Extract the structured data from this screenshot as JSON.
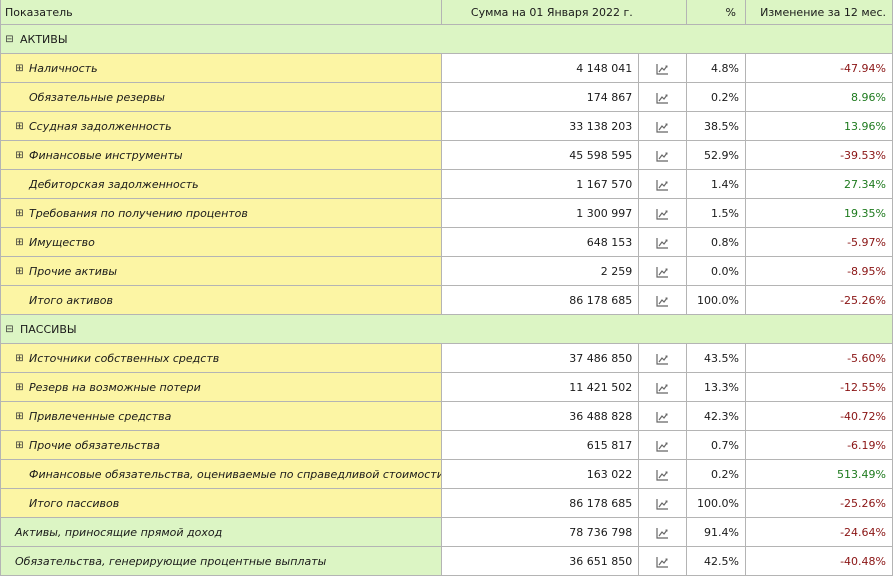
{
  "header": {
    "col_name": "Показатель",
    "col_sum": "Сумма на 01 Января 2022 г.",
    "col_pct": "%",
    "col_change": "Изменение за 12 мес."
  },
  "rows": [
    {
      "type": "section",
      "label": "АКТИВЫ",
      "expander": "⊟"
    },
    {
      "type": "item",
      "color": "yel",
      "expander": "⊞",
      "label": "Наличность",
      "sum": "4 148 041",
      "pct": "4.8%",
      "change": "-47.94%",
      "sign": "neg"
    },
    {
      "type": "item",
      "color": "yel",
      "expander": "",
      "label": "Обязательные резервы",
      "sum": "174 867",
      "pct": "0.2%",
      "change": "8.96%",
      "sign": "pos"
    },
    {
      "type": "item",
      "color": "yel",
      "expander": "⊞",
      "label": "Ссудная задолженность",
      "sum": "33 138 203",
      "pct": "38.5%",
      "change": "13.96%",
      "sign": "pos"
    },
    {
      "type": "item",
      "color": "yel",
      "expander": "⊞",
      "label": "Финансовые инструменты",
      "sum": "45 598 595",
      "pct": "52.9%",
      "change": "-39.53%",
      "sign": "neg"
    },
    {
      "type": "item",
      "color": "yel",
      "expander": "",
      "label": "Дебиторская задолженность",
      "sum": "1 167 570",
      "pct": "1.4%",
      "change": "27.34%",
      "sign": "pos"
    },
    {
      "type": "item",
      "color": "yel",
      "expander": "⊞",
      "label": "Требования по получению процентов",
      "sum": "1 300 997",
      "pct": "1.5%",
      "change": "19.35%",
      "sign": "pos"
    },
    {
      "type": "item",
      "color": "yel",
      "expander": "⊞",
      "label": "Имущество",
      "sum": "648 153",
      "pct": "0.8%",
      "change": "-5.97%",
      "sign": "neg"
    },
    {
      "type": "item",
      "color": "yel",
      "expander": "⊞",
      "label": "Прочие активы",
      "sum": "2 259",
      "pct": "0.0%",
      "change": "-8.95%",
      "sign": "neg"
    },
    {
      "type": "item",
      "color": "yel",
      "expander": "",
      "label": "Итого активов",
      "sum": "86 178 685",
      "pct": "100.0%",
      "change": "-25.26%",
      "sign": "neg"
    },
    {
      "type": "section",
      "label": "ПАССИВЫ",
      "expander": "⊟"
    },
    {
      "type": "item",
      "color": "yel",
      "expander": "⊞",
      "label": "Источники собственных средств",
      "sum": "37 486 850",
      "pct": "43.5%",
      "change": "-5.60%",
      "sign": "neg"
    },
    {
      "type": "item",
      "color": "yel",
      "expander": "⊞",
      "label": "Резерв на возможные потери",
      "sum": "11 421 502",
      "pct": "13.3%",
      "change": "-12.55%",
      "sign": "neg"
    },
    {
      "type": "item",
      "color": "yel",
      "expander": "⊞",
      "label": "Привлеченные средства",
      "sum": "36 488 828",
      "pct": "42.3%",
      "change": "-40.72%",
      "sign": "neg"
    },
    {
      "type": "item",
      "color": "yel",
      "expander": "⊞",
      "label": "Прочие обязательства",
      "sum": "615 817",
      "pct": "0.7%",
      "change": "-6.19%",
      "sign": "neg"
    },
    {
      "type": "item",
      "color": "yel",
      "expander": "",
      "label": "Финансовые обязательства, оцениваемые по справедливой стоимости",
      "sum": "163 022",
      "pct": "0.2%",
      "change": "513.49%",
      "sign": "pos"
    },
    {
      "type": "item",
      "color": "yel",
      "expander": "",
      "label": "Итого пассивов",
      "sum": "86 178 685",
      "pct": "100.0%",
      "change": "-25.26%",
      "sign": "neg"
    },
    {
      "type": "summary",
      "color": "grn",
      "label": "Активы, приносящие прямой доход",
      "sum": "78 736 798",
      "pct": "91.4%",
      "change": "-24.64%",
      "sign": "neg"
    },
    {
      "type": "summary",
      "color": "grn",
      "label": "Обязательства, генерирующие процентные выплаты",
      "sum": "36 651 850",
      "pct": "42.5%",
      "change": "-40.48%",
      "sign": "neg"
    }
  ],
  "icons": {
    "chart": "line-chart-icon",
    "expand": "plus-square-icon",
    "collapse": "minus-square-icon"
  },
  "colors": {
    "header_green": "#dcf5c4",
    "row_yellow": "#fcf5a4",
    "negative": "#8a1414",
    "positive": "#1e7a1e"
  }
}
